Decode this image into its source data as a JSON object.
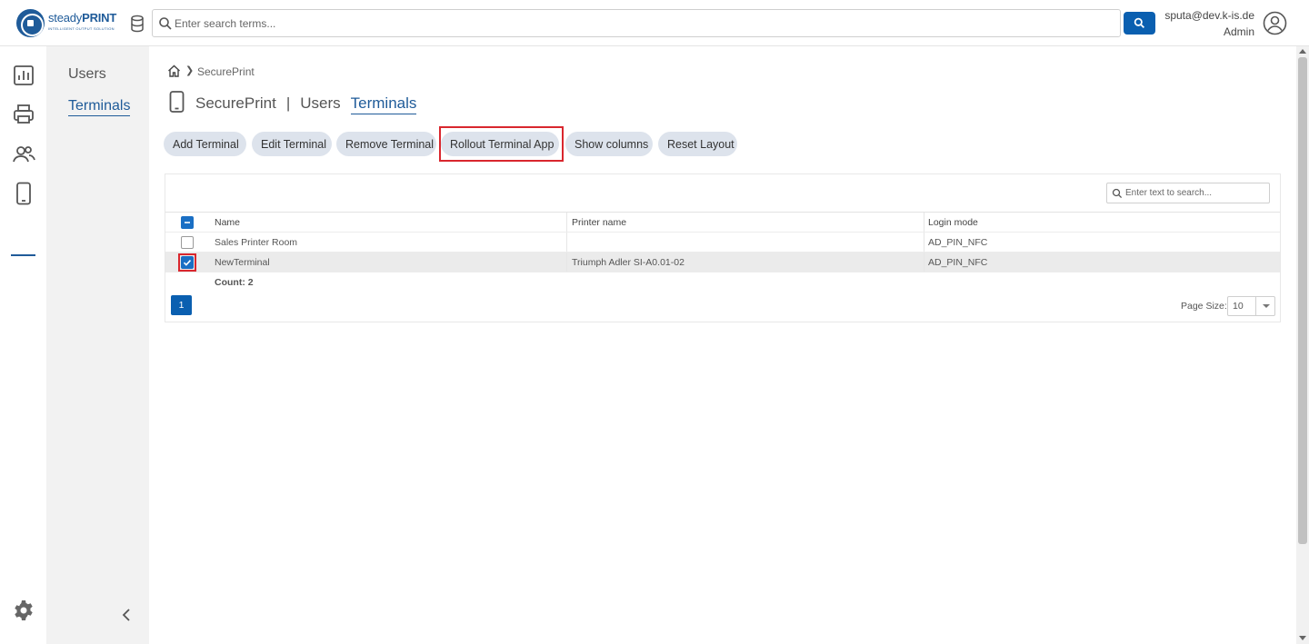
{
  "header": {
    "logo_name_regular": "steady",
    "logo_name_bold": "PRINT",
    "logo_tagline": "INTELLIGENT OUTPUT SOLUTION",
    "search_placeholder": "Enter search terms...",
    "user_email": "sputa@dev.k-is.de",
    "user_role": "Admin"
  },
  "rail": {
    "icons": [
      "dashboard-icon",
      "printer-icon",
      "users-icon",
      "phone-icon"
    ],
    "active": "phone-icon",
    "bottom_icon": "gear-icon"
  },
  "subnav": {
    "items": [
      {
        "label": "Users",
        "active": false
      },
      {
        "label": "Terminals",
        "active": true
      }
    ]
  },
  "breadcrumb": {
    "current": "SecurePrint"
  },
  "title": {
    "parts": [
      {
        "label": "SecurePrint",
        "active": false
      },
      {
        "label": "Users",
        "active": false
      },
      {
        "label": "Terminals",
        "active": true
      }
    ],
    "separator": "|"
  },
  "toolbar": {
    "buttons": [
      {
        "label": "Add Terminal"
      },
      {
        "label": "Edit Terminal"
      },
      {
        "label": "Remove Terminal"
      },
      {
        "label": "Rollout Terminal App",
        "highlighted": true
      },
      {
        "label": "Show columns"
      },
      {
        "label": "Reset Layout"
      }
    ]
  },
  "grid": {
    "search_placeholder": "Enter text to search...",
    "columns": [
      "Name",
      "Printer name",
      "Login mode"
    ],
    "rows": [
      {
        "name": "Sales Printer Room",
        "printer_name": "",
        "login_mode": "AD_PIN_NFC",
        "selected": false
      },
      {
        "name": "NewTerminal",
        "printer_name": "Triumph Adler SI-A0.01-02",
        "login_mode": "AD_PIN_NFC",
        "selected": true
      }
    ],
    "count_label": "Count: 2",
    "current_page": "1",
    "page_size_label": "Page Size:",
    "page_size_value": "10"
  },
  "colors": {
    "brand": "#1f5b99",
    "primary_button": "#0a5fb0",
    "toolbar_button_bg": "#dde3ec",
    "highlight": "#d9272e"
  }
}
